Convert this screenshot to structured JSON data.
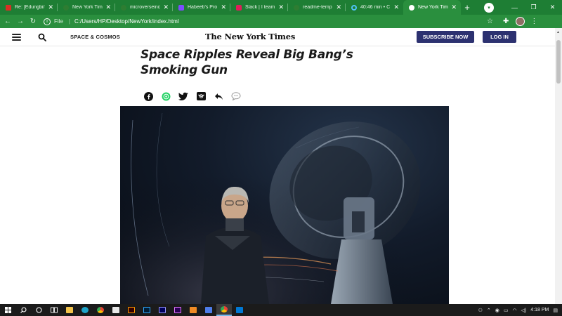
{
  "browser": {
    "tabs": [
      {
        "label": "Re: [Edungbi/",
        "favicon": "gmail-icon",
        "color": "#d93025",
        "active": false
      },
      {
        "label": "New York Tim",
        "favicon": "page-icon",
        "color": "#2e7d32",
        "active": false
      },
      {
        "label": "microverseinc",
        "favicon": "page-icon",
        "color": "#2e7d32",
        "active": false
      },
      {
        "label": "Habeeb's Pro",
        "favicon": "app-icon",
        "color": "#7c4dff",
        "active": false
      },
      {
        "label": "Slack | I team",
        "favicon": "slack-icon",
        "color": "#e01e5a",
        "active": false
      },
      {
        "label": "readme-temp",
        "favicon": "page-icon",
        "color": "#2e7d32",
        "active": false
      },
      {
        "label": "40:46 min • C",
        "favicon": "timer-icon",
        "color": "#4fc3f7",
        "active": false
      },
      {
        "label": "New York Tim",
        "favicon": "globe-icon",
        "color": "#ffffff",
        "active": true
      }
    ],
    "address": {
      "scheme": "File",
      "url": "C:/Users/HP/Desktop/NewYork/index.html"
    }
  },
  "site": {
    "section": "SPACE & COSMOS",
    "logo": "The New York Times",
    "subscribe_label": "SUBSCRIBE NOW",
    "login_label": "LOG IN"
  },
  "article": {
    "headline_line1": "Space Ripples Reveal Big Bang’s",
    "headline_line2": "Smoking Gun"
  },
  "share": [
    {
      "name": "facebook-icon"
    },
    {
      "name": "whatsapp-icon"
    },
    {
      "name": "twitter-icon"
    },
    {
      "name": "email-icon"
    },
    {
      "name": "reply-icon"
    },
    {
      "name": "comment-icon"
    }
  ],
  "taskbar": {
    "time": "4:18 PM",
    "apps": [
      "windows-icon",
      "search-icon",
      "cortana-icon",
      "task-view-icon",
      "file-explorer-icon",
      "edge-icon",
      "chrome-icon",
      "mail-icon",
      "illustrator-icon",
      "photoshop-icon",
      "after-effects-icon",
      "premiere-icon",
      "aff-designer-icon",
      "media-icon",
      "chrome-active-icon",
      "vscode-icon"
    ],
    "notification_count": ""
  }
}
